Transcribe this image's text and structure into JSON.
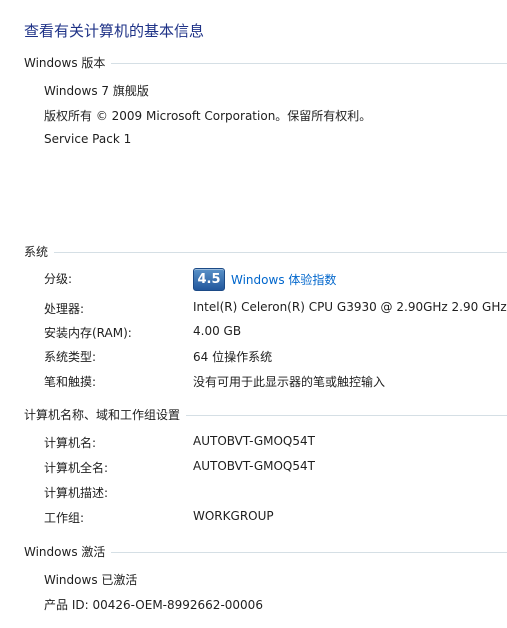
{
  "page_title": "查看有关计算机的基本信息",
  "edition": {
    "header": "Windows 版本",
    "name": "Windows 7 旗舰版",
    "copyright": "版权所有 © 2009 Microsoft Corporation。保留所有权利。",
    "service_pack": "Service Pack 1"
  },
  "system": {
    "header": "系统",
    "rating_label": "分级:",
    "rating_score": "4.5",
    "rating_link": "Windows 体验指数",
    "processor_label": "处理器:",
    "processor_value": "Intel(R) Celeron(R) CPU G3930 @ 2.90GHz   2.90 GHz",
    "ram_label": "安装内存(RAM):",
    "ram_value": "4.00 GB",
    "type_label": "系统类型:",
    "type_value": "64 位操作系统",
    "pen_label": "笔和触摸:",
    "pen_value": "没有可用于此显示器的笔或触控输入"
  },
  "computer": {
    "header": "计算机名称、域和工作组设置",
    "name_label": "计算机名:",
    "name_value": "AUTOBVT-GMOQ54T",
    "fullname_label": "计算机全名:",
    "fullname_value": "AUTOBVT-GMOQ54T",
    "desc_label": "计算机描述:",
    "desc_value": "",
    "workgroup_label": "工作组:",
    "workgroup_value": "WORKGROUP"
  },
  "activation": {
    "header": "Windows 激活",
    "status": "Windows 已激活",
    "product_id": "产品 ID: 00426-OEM-8992662-00006"
  }
}
